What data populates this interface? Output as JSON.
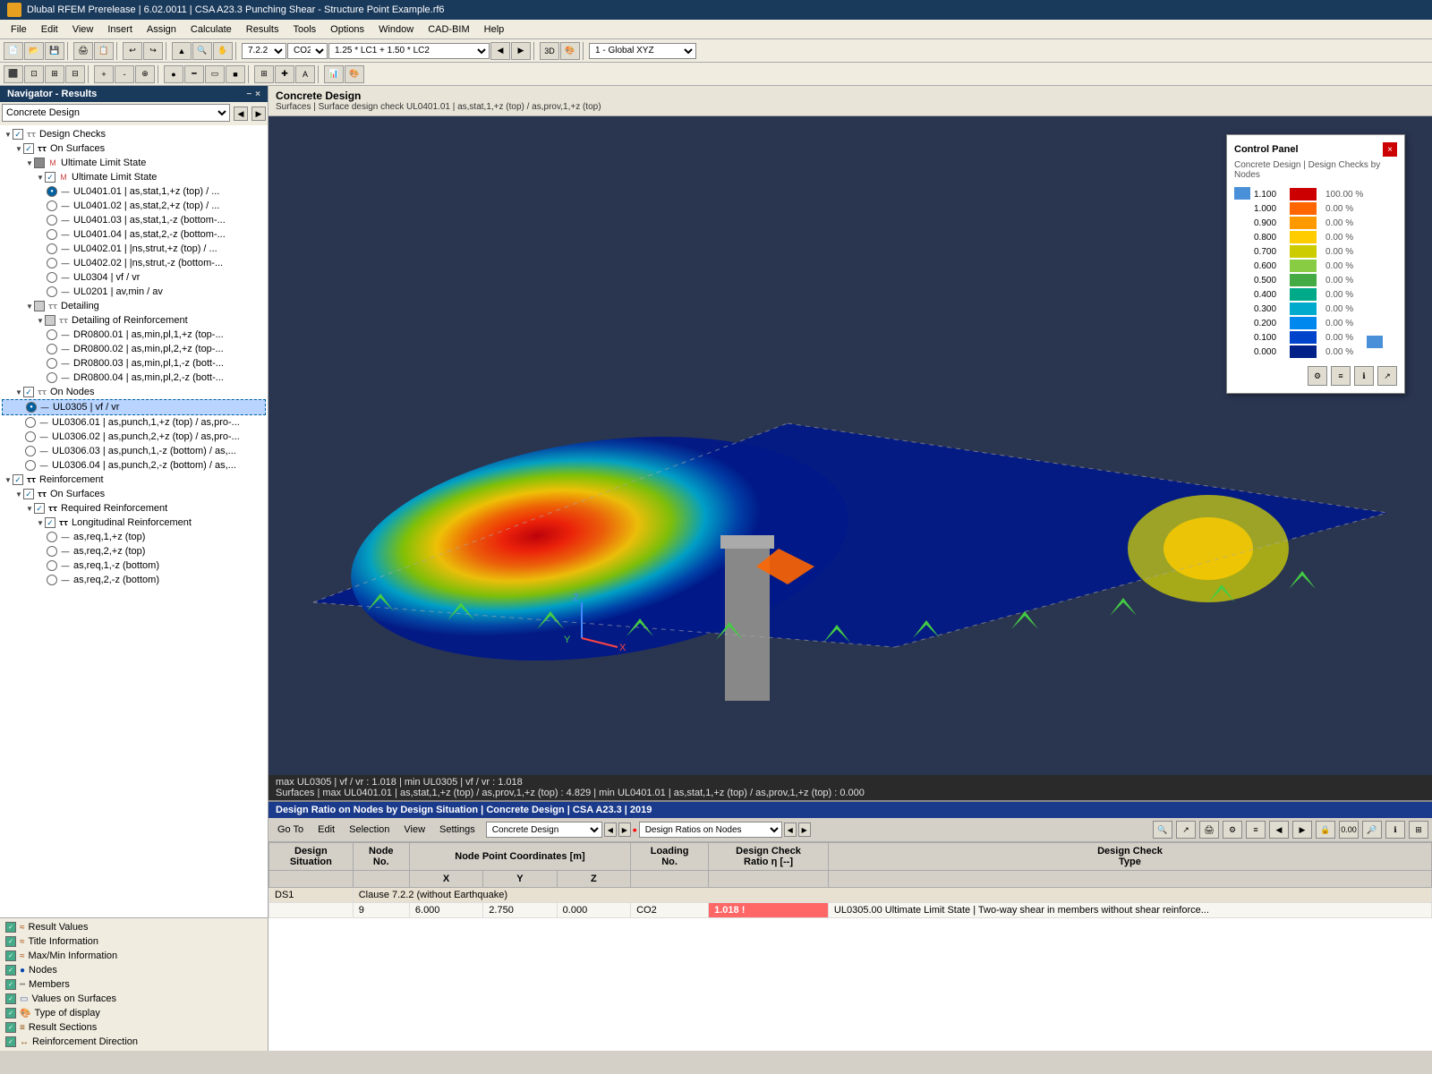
{
  "app": {
    "title": "Dlubal RFEM Prerelease | 6.02.0011 | CSA A23.3 Punching Shear - Structure Point Example.rf6",
    "icon": "dlubal-icon"
  },
  "menu": {
    "items": [
      "File",
      "Edit",
      "View",
      "Insert",
      "Assign",
      "Calculate",
      "Results",
      "Tools",
      "Options",
      "Window",
      "CAD-BIM",
      "Help"
    ]
  },
  "toolbar1": {
    "combo1": "7.2.2",
    "combo2": "CO2",
    "combo3": "1.25 * LC1 + 1.50 * LC2",
    "coord_system": "1 - Global XYZ"
  },
  "navigator": {
    "title": "Navigator - Results",
    "dropdown": "Concrete Design",
    "tree": [
      {
        "id": "design-checks",
        "label": "Design Checks",
        "level": 0,
        "type": "checkbox",
        "checked": true,
        "expanded": true
      },
      {
        "id": "on-surfaces-1",
        "label": "On Surfaces",
        "level": 1,
        "type": "checkbox",
        "checked": true,
        "expanded": true
      },
      {
        "id": "ultimate-limit-state-1",
        "label": "Ultimate Limit State",
        "level": 2,
        "type": "checkbox",
        "checked": false,
        "expanded": true
      },
      {
        "id": "ultimate-limit-state-2",
        "label": "Ultimate Limit State",
        "level": 3,
        "type": "checkbox",
        "checked": true,
        "expanded": true
      },
      {
        "id": "ul0401-01",
        "label": "UL0401.01 | as,stat,1,+z (top) / ...",
        "level": 4,
        "type": "radio",
        "selected": true
      },
      {
        "id": "ul0401-02",
        "label": "UL0401.02 | as,stat,2,+z (top) / ...",
        "level": 4,
        "type": "radio",
        "selected": false
      },
      {
        "id": "ul0401-03",
        "label": "UL0401.03 | as,stat,1,-z (bottom-...",
        "level": 4,
        "type": "radio",
        "selected": false
      },
      {
        "id": "ul0401-04",
        "label": "UL0401.04 | as,stat,2,-z (bottom-...",
        "level": 4,
        "type": "radio",
        "selected": false
      },
      {
        "id": "ul0402-01",
        "label": "UL0402.01 | |ns,strut,+z (top) / ...",
        "level": 4,
        "type": "radio",
        "selected": false
      },
      {
        "id": "ul0402-02",
        "label": "UL0402.02 | |ns,strut,-z (bottom-...",
        "level": 4,
        "type": "radio",
        "selected": false
      },
      {
        "id": "ul0304",
        "label": "UL0304 | vf / vr",
        "level": 4,
        "type": "radio",
        "selected": false
      },
      {
        "id": "ul0201",
        "label": "UL0201 | av,min / av",
        "level": 4,
        "type": "radio",
        "selected": false
      },
      {
        "id": "detailing",
        "label": "Detailing",
        "level": 2,
        "type": "checkbox",
        "checked": false,
        "expanded": true
      },
      {
        "id": "detailing-reinforcement",
        "label": "Detailing of Reinforcement",
        "level": 3,
        "type": "checkbox",
        "checked": false,
        "expanded": true
      },
      {
        "id": "dr0800-01",
        "label": "DR0800.01 | as,min,pl,1,+z (top-...",
        "level": 4,
        "type": "radio",
        "selected": false
      },
      {
        "id": "dr0800-02",
        "label": "DR0800.02 | as,min,pl,2,+z (top-...",
        "level": 4,
        "type": "radio",
        "selected": false
      },
      {
        "id": "dr0800-03",
        "label": "DR0800.03 | as,min,pl,1,-z (bott-...",
        "level": 4,
        "type": "radio",
        "selected": false
      },
      {
        "id": "dr0800-04",
        "label": "DR0800.04 | as,min,pl,2,-z (bott-...",
        "level": 4,
        "type": "radio",
        "selected": false
      },
      {
        "id": "on-nodes",
        "label": "On Nodes",
        "level": 1,
        "type": "checkbox",
        "checked": true,
        "expanded": true
      },
      {
        "id": "ul0305",
        "label": "UL0305 | vf / vr",
        "level": 2,
        "type": "radio",
        "selected": true,
        "highlighted": true
      },
      {
        "id": "ul0306-01",
        "label": "UL0306.01 | as,punch,1,+z (top) / as,pro-...",
        "level": 2,
        "type": "radio",
        "selected": false
      },
      {
        "id": "ul0306-02",
        "label": "UL0306.02 | as,punch,2,+z (top) / as,pro-...",
        "level": 2,
        "type": "radio",
        "selected": false
      },
      {
        "id": "ul0306-03",
        "label": "UL0306.03 | as,punch,1,-z (bottom) / as,...",
        "level": 2,
        "type": "radio",
        "selected": false
      },
      {
        "id": "ul0306-04",
        "label": "UL0306.04 | as,punch,2,-z (bottom) / as,...",
        "level": 2,
        "type": "radio",
        "selected": false
      },
      {
        "id": "reinforcement",
        "label": "Reinforcement",
        "level": 0,
        "type": "checkbox",
        "checked": true,
        "expanded": true
      },
      {
        "id": "on-surfaces-2",
        "label": "On Surfaces",
        "level": 1,
        "type": "checkbox",
        "checked": true,
        "expanded": true
      },
      {
        "id": "required-reinforcement",
        "label": "Required Reinforcement",
        "level": 2,
        "type": "checkbox",
        "checked": true,
        "expanded": true
      },
      {
        "id": "longitudinal-reinforcement",
        "label": "Longitudinal Reinforcement",
        "level": 3,
        "type": "checkbox",
        "checked": true,
        "expanded": true
      },
      {
        "id": "as-req-1-top",
        "label": "as,req,1,+z (top)",
        "level": 4,
        "type": "radio",
        "selected": false
      },
      {
        "id": "as-req-2-top",
        "label": "as,req,2,+z (top)",
        "level": 4,
        "type": "radio",
        "selected": false
      },
      {
        "id": "as-req-1-bottom",
        "label": "as,req,1,-z (bottom)",
        "level": 4,
        "type": "radio",
        "selected": false
      },
      {
        "id": "as-req-2-bottom",
        "label": "as,req,2,-z (bottom)",
        "level": 4,
        "type": "radio",
        "selected": false
      }
    ]
  },
  "nav_bottom": {
    "items": [
      {
        "id": "result-values",
        "label": "Result Values",
        "checked": true
      },
      {
        "id": "title-information",
        "label": "Title Information",
        "checked": true
      },
      {
        "id": "max-min-information",
        "label": "Max/Min Information",
        "checked": true
      },
      {
        "id": "nodes",
        "label": "Nodes",
        "checked": true
      },
      {
        "id": "members",
        "label": "Members",
        "checked": true
      },
      {
        "id": "values-on-surfaces",
        "label": "Values on Surfaces",
        "checked": true
      },
      {
        "id": "type-of-display",
        "label": "Type of display",
        "checked": true
      },
      {
        "id": "result-sections",
        "label": "Result Sections",
        "checked": true
      },
      {
        "id": "reinforcement-direction",
        "label": "Reinforcement Direction",
        "checked": true
      }
    ]
  },
  "content": {
    "title": "Concrete Design",
    "subtitle": "Surfaces | Surface design check UL0401.01 | as,stat,1,+z (top) / as,prov,1,+z (top)"
  },
  "control_panel": {
    "title": "Control Panel",
    "subtitle": "Concrete Design | Design Checks by Nodes",
    "scale": [
      {
        "value": "1.100",
        "color": "#cc0000",
        "pct": "100.00 %"
      },
      {
        "value": "1.000",
        "color": "#ff6600",
        "pct": "0.00 %"
      },
      {
        "value": "0.900",
        "color": "#ff9900",
        "pct": "0.00 %"
      },
      {
        "value": "0.800",
        "color": "#ffcc00",
        "pct": "0.00 %"
      },
      {
        "value": "0.700",
        "color": "#cccc00",
        "pct": "0.00 %"
      },
      {
        "value": "0.600",
        "color": "#99cc00",
        "pct": "0.00 %"
      },
      {
        "value": "0.500",
        "color": "#44aa44",
        "pct": "0.00 %"
      },
      {
        "value": "0.400",
        "color": "#00aa88",
        "pct": "0.00 %"
      },
      {
        "value": "0.300",
        "color": "#00aacc",
        "pct": "0.00 %"
      },
      {
        "value": "0.200",
        "color": "#0088ee",
        "pct": "0.00 %"
      },
      {
        "value": "0.100",
        "color": "#0044cc",
        "pct": "0.00 %"
      },
      {
        "value": "0.000",
        "color": "#002288",
        "pct": "0.00 %"
      }
    ]
  },
  "viewport_status": {
    "line1": "max UL0305 | vf / vr : 1.018 | min UL0305 | vf / vr : 1.018",
    "line2": "Surfaces | max UL0401.01 | as,stat,1,+z (top) / as,prov,1,+z (top) : 4.829 | min UL0401.01 | as,stat,1,+z (top) / as,prov,1,+z (top) : 0.000"
  },
  "results": {
    "title": "Design Ratio on Nodes by Design Situation | Concrete Design | CSA A23.3 | 2019",
    "nav_items": [
      "Go To",
      "Edit",
      "Selection",
      "View",
      "Settings"
    ],
    "combo1": "Concrete Design",
    "combo2": "Design Ratios on Nodes",
    "columns": [
      "Design Situation",
      "Node No.",
      "Node Point Coordinates [m]\nX",
      "Node Point Coordinates [m]\nY",
      "Node Point Coordinates [m]\nZ",
      "Loading No.",
      "Design Check Ratio η [--]",
      "Design Check Type"
    ],
    "col_headers": [
      "Design Situation",
      "Node No.",
      "X",
      "Y",
      "Z",
      "Loading No.",
      "Design Check Ratio η [--]",
      "Design Check Type"
    ],
    "rows": [
      {
        "situation": "DS1",
        "node": "",
        "clause": "Clause 7.2.2 (without Earthquake)",
        "colspan": true
      },
      {
        "situation": "",
        "node": "9",
        "x": "6.000",
        "y": "2.750",
        "z": "0.000",
        "loading": "CO2",
        "ratio": "1.018",
        "type": "UL0305.00 Ultimate Limit State | Two-way shear in members without shear reinforce...",
        "highlight": true
      }
    ]
  }
}
